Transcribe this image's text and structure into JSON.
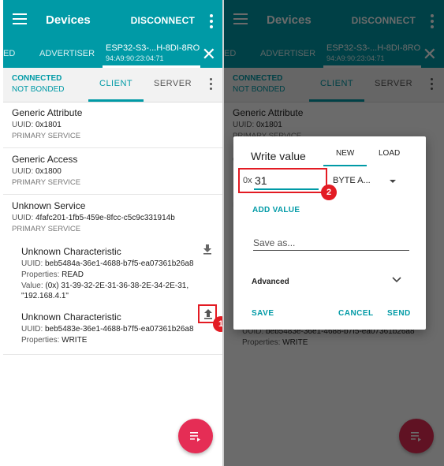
{
  "app": {
    "title": "Devices",
    "disconnect_label": "DISCONNECT"
  },
  "tabs": {
    "partial_first": "ED",
    "advertiser": "ADVERTISER",
    "device_name": "ESP32-S3-...H-8DI-8RO",
    "device_mac": "94:A9:90:23:04:71"
  },
  "connection": {
    "state": "CONNECTED",
    "bond": "NOT BONDED",
    "tab_client": "CLIENT",
    "tab_server": "SERVER"
  },
  "services": [
    {
      "name": "Generic Attribute",
      "uuid_label": "UUID: ",
      "uuid": "0x1801",
      "type": "PRIMARY SERVICE"
    },
    {
      "name": "Generic Access",
      "uuid_label": "UUID: ",
      "uuid": "0x1800",
      "type": "PRIMARY SERVICE"
    },
    {
      "name": "Unknown Service",
      "uuid_label": "UUID: ",
      "uuid": "4fafc201-1fb5-459e-8fcc-c5c9c331914b",
      "type": "PRIMARY SERVICE"
    }
  ],
  "characteristics": [
    {
      "name": "Unknown Characteristic",
      "uuid_label": "UUID: ",
      "uuid": "beb5484a-36e1-4688-b7f5-ea07361b26a8",
      "props_label": "Properties: ",
      "props": "READ",
      "value_label": "Value: ",
      "value_line1": "(0x) 31-39-32-2E-31-36-38-2E-34-2E-31,",
      "value_line2": "\"192.168.4.1\""
    },
    {
      "name": "Unknown Characteristic",
      "uuid_label": "UUID: ",
      "uuid": "beb5483e-36e1-4688-b7f5-ea07361b26a8",
      "props_label": "Properties: ",
      "props": "WRITE"
    }
  ],
  "annotations": {
    "step1": "1",
    "step2": "2"
  },
  "right_panel": {
    "last_uuid_fragment": "beb5483e-36e1-4688-b7f5-ea07361b26a8"
  },
  "dialog": {
    "title": "Write value",
    "tab_new": "NEW",
    "tab_load": "LOAD",
    "hex_prefix": "0x",
    "hex_value": "31",
    "type_select": "BYTE A...",
    "add_value": "ADD VALUE",
    "save_as_placeholder": "Save as...",
    "advanced": "Advanced",
    "save": "SAVE",
    "cancel": "CANCEL",
    "send": "SEND"
  },
  "colors": {
    "primary": "#009aa6",
    "accent_fab": "#e52d55",
    "annotation_red": "#e31b23"
  },
  "icons": [
    "menu-icon",
    "more-vert-icon",
    "close-icon",
    "download-icon",
    "upload-icon",
    "fab-list-icon",
    "chevron-down-icon"
  ]
}
